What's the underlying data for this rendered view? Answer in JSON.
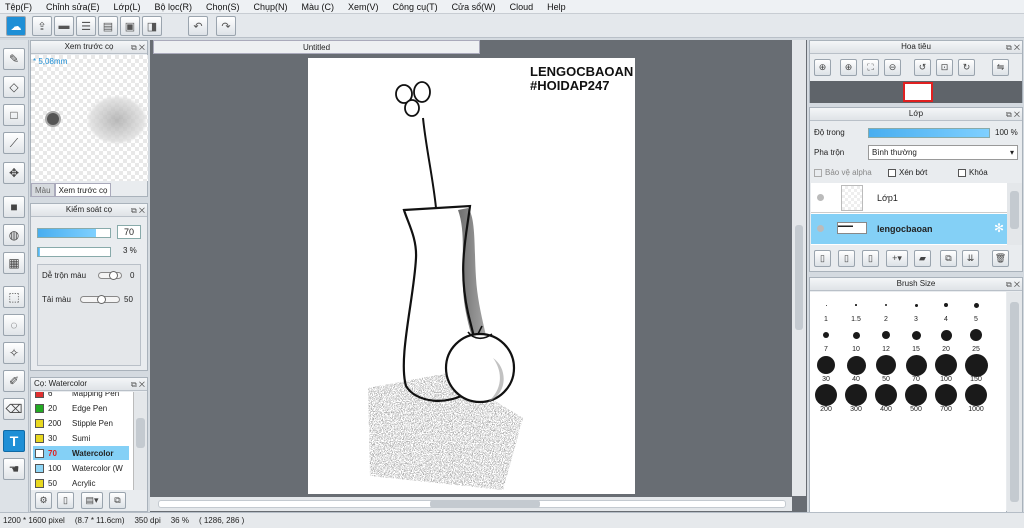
{
  "menu": [
    "Tệp(F)",
    "Chỉnh sửa(E)",
    "Lớp(L)",
    "Bộ lọc(R)",
    "Chọn(S)",
    "Chụp(N)",
    "Màu (C)",
    "Xem(V)",
    "Công cụ(T)",
    "Cửa sổ(W)",
    "Cloud",
    "Help"
  ],
  "preview_panel": {
    "title": "Xem trước cọ",
    "size_label": "* 5,08mm",
    "tabs": [
      "Màu",
      "Xem trước cọ"
    ]
  },
  "brush_control": {
    "title": "Kiểm soát cọ",
    "opacity_value": "70",
    "opacity_fraction": 0.8,
    "second_value": "3 %",
    "second_fraction": 0.03,
    "blend_label": "Dễ trộn màu",
    "blend_value": "0",
    "blend_fraction": 0.0,
    "reload_label": "Tải màu",
    "reload_value": "50",
    "reload_fraction": 0.5
  },
  "brush_list": {
    "title": "Cọ: Watercolor",
    "items": [
      {
        "size": "6",
        "name": "Mapping Pen",
        "color": "#e03030",
        "selected": false
      },
      {
        "size": "20",
        "name": "Edge Pen",
        "color": "#22aa22",
        "selected": false
      },
      {
        "size": "200",
        "name": "Stipple Pen",
        "color": "#e8d820",
        "selected": false
      },
      {
        "size": "30",
        "name": "Sumi",
        "color": "#e8d820",
        "selected": false
      },
      {
        "size": "70",
        "name": "Watercolor",
        "color": "#ffffff",
        "selected": true
      },
      {
        "size": "100",
        "name": "Watercolor (W",
        "color": "#8fd6f6",
        "selected": false
      },
      {
        "size": "50",
        "name": "Acrylic",
        "color": "#e8d820",
        "selected": false
      }
    ]
  },
  "document": {
    "tab_title": "Untitled",
    "text1": "LENGOCBAOAN",
    "text2": "#HOIDAP247"
  },
  "navigator": {
    "title": "Hoa tiêu"
  },
  "layers": {
    "title": "Lớp",
    "opacity_label": "Độ trong",
    "opacity_value": "100 %",
    "opacity_fraction": 1.0,
    "blend_label": "Pha trộn",
    "blend_value": "Bình thường",
    "protect_alpha": "Bảo vệ alpha",
    "clip": "Xén bớt",
    "lock": "Khóa",
    "items": [
      {
        "name": "Lớp1",
        "selected": false
      },
      {
        "name": "lengocbaoan",
        "selected": true
      }
    ]
  },
  "brush_size": {
    "title": "Brush Size",
    "sizes": [
      "1",
      "1.5",
      "2",
      "3",
      "4",
      "5",
      "7",
      "10",
      "12",
      "15",
      "20",
      "25",
      "30",
      "40",
      "50",
      "70",
      "100",
      "150",
      "200",
      "300",
      "400",
      "500",
      "700",
      "1000"
    ]
  },
  "status": {
    "dims": "1200 * 1600 pixel",
    "cm": "(8.7 * 11.6cm)",
    "dpi": "350 dpi",
    "zoom": "36 %",
    "coords": "( 1286, 286 )"
  },
  "colors": {
    "accent": "#1e8fd6",
    "selection": "#84d0f6"
  }
}
